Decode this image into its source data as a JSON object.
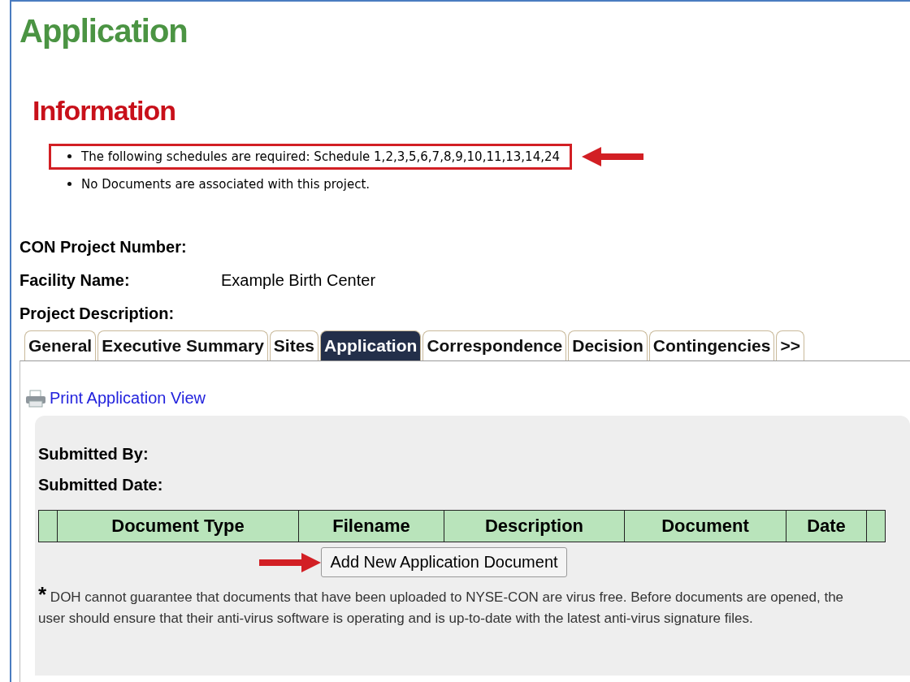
{
  "page": {
    "title": "Application"
  },
  "information": {
    "heading": "Information",
    "items": [
      {
        "text": "The following schedules are required: Schedule 1,2,3,5,6,7,8,9,10,11,13,14,24",
        "highlighted": true
      },
      {
        "text": "No Documents are associated with this project.",
        "highlighted": false
      }
    ]
  },
  "fields": [
    {
      "label": "CON Project Number:"
    },
    {
      "label": "Facility Name:",
      "value": "Example Birth Center"
    },
    {
      "label": "Project Description:"
    }
  ],
  "tabs": [
    {
      "label": "General",
      "selected": false
    },
    {
      "label": "Executive Summary",
      "selected": false
    },
    {
      "label": "Sites",
      "selected": false
    },
    {
      "label": "Application",
      "selected": true
    },
    {
      "label": "Correspondence",
      "selected": false
    },
    {
      "label": "Decision",
      "selected": false
    },
    {
      "label": "Contingencies",
      "selected": false
    },
    {
      "label": ">>",
      "selected": false
    }
  ],
  "print_link": "Print Application View",
  "submitted": [
    {
      "label": "Submitted By:"
    },
    {
      "label": "Submitted Date:"
    }
  ],
  "table": {
    "columns": [
      "Document Type",
      "Filename",
      "Description",
      "Document",
      "Date"
    ]
  },
  "add_button": {
    "label": "Add New Application Document",
    "callout": true
  },
  "disclaimer": {
    "mark": "*",
    "text": "DOH cannot guarantee that documents that have been uploaded to NYSE-CON are virus free. Before documents are opened, the user should ensure that their anti-virus software is operating and is up-to-date with the latest anti-virus signature files."
  }
}
